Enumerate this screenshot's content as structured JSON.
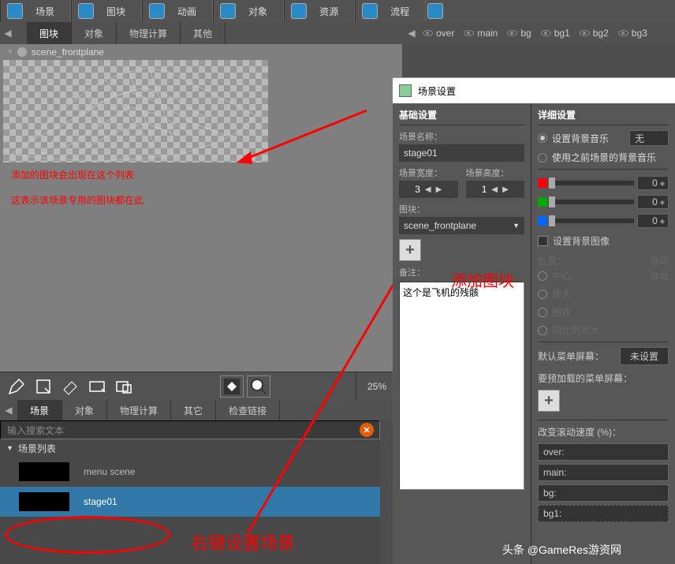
{
  "toolbar": {
    "items": [
      {
        "label": "场景"
      },
      {
        "label": "图块"
      },
      {
        "label": "动画"
      },
      {
        "label": "对象"
      },
      {
        "label": "资源"
      },
      {
        "label": "流程"
      }
    ]
  },
  "subTabs": [
    "图块",
    "对象",
    "物理计算",
    "其他"
  ],
  "scene": {
    "name": "scene_frontplane"
  },
  "annotation1_line1": "添加的图块会出现在这个列表",
  "annotation1_line2": "这表示该场景专用的图块都在此",
  "annotation2": "右键设置场景",
  "annotation3": "添加图块",
  "zoom": "25%",
  "lowerTabs": [
    "场景",
    "对象",
    "物理计算",
    "其它",
    "检查链接"
  ],
  "search": {
    "placeholder": "输入搜索文本"
  },
  "sceneList": {
    "header": "场景列表",
    "items": [
      "menu scene",
      "stage01"
    ]
  },
  "eyeBar": [
    "over",
    "main",
    "bg",
    "bg1",
    "bg2",
    "bg3"
  ],
  "dialog": {
    "title": "场景设置",
    "basic": {
      "header": "基础设置",
      "sceneNameLabel": "场景名称：",
      "sceneName": "stage01",
      "widthLabel": "场景宽度：",
      "heightLabel": "场景高度：",
      "width": "3",
      "height": "1",
      "tileLabel": "图块：",
      "tileName": "scene_frontplane",
      "noteLabel": "备注：",
      "noteValue": "这个是飞机的残骸"
    },
    "detail": {
      "header": "详细设置",
      "bgmLabel": "设置背景音乐",
      "bgmNone": "无",
      "prevBgm": "使用之前场景的背景音乐",
      "sliderVal0": "0",
      "sliderVal1": "0",
      "sliderVal2": "0",
      "bgImgLabel": "设置背景图像",
      "autoLabel": "自动",
      "posLabel": "位置：",
      "centerLabel": "中心",
      "zoomInLabel": "放大",
      "tileBlockLabel": "图块",
      "proportionLabel": "同比例放大",
      "defaultMenuLabel": "默认菜单屏幕：",
      "noneSet": "未设置",
      "preloadLabel": "要预加载的菜单屏幕：",
      "scrollLabel": "改变滚动速度 (%)：",
      "layers": [
        "over:",
        "main:",
        "bg:",
        "bg1:"
      ]
    }
  },
  "watermark": "头条 @GameRes游资网"
}
